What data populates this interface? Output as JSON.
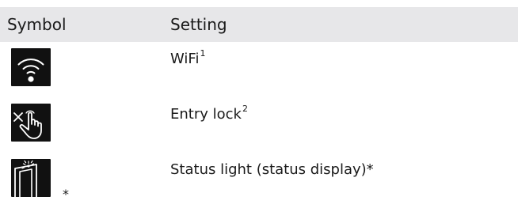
{
  "table": {
    "header": {
      "symbol": "Symbol",
      "setting": "Setting"
    },
    "rows": [
      {
        "icon": "wifi-icon",
        "label": "WiFi",
        "footnote": "1"
      },
      {
        "icon": "entry-lock-icon",
        "label": "Entry lock",
        "footnote": "2"
      },
      {
        "icon": "status-light-icon",
        "label": "Status light (status display)*",
        "icon_suffix": "*"
      }
    ]
  }
}
